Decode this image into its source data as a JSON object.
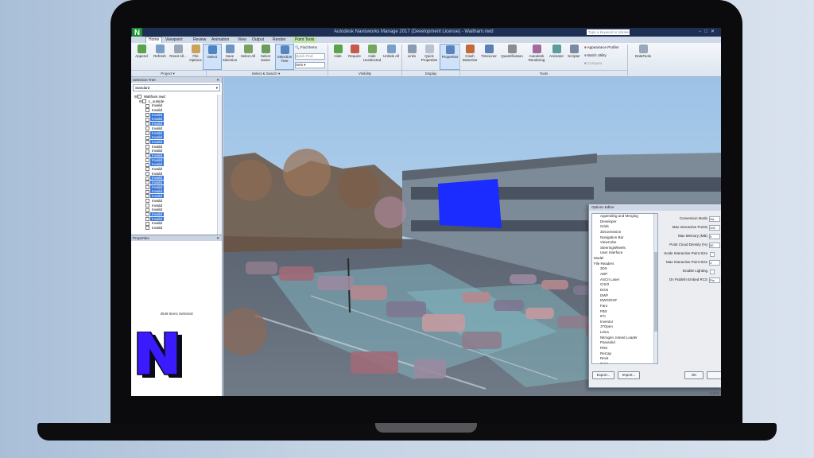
{
  "window": {
    "title": "Autodesk Navisworks Manage 2017 (Development License) - Waltham.nwd",
    "app_icon_letter": "N",
    "search_placeholder": "Type a keyword or phrase",
    "controls": [
      "−",
      "□",
      "✕"
    ]
  },
  "tabs": [
    "Home",
    "Viewpoint",
    "Review",
    "Animation",
    "View",
    "Output",
    "Render",
    "Point Tools"
  ],
  "ribbon": {
    "project_buttons": [
      "Append",
      "Refresh",
      "Reset All...",
      "File Options"
    ],
    "select_buttons": [
      "Select",
      "Save Selection",
      "Select All",
      "Select Same",
      "Selection Tree"
    ],
    "find_items": "Find Items",
    "quick_find_placeholder": "Quick Find",
    "sets_label": "Sets",
    "visibility_buttons": [
      "Hide",
      "Require",
      "Hide Unselected",
      "Unhide All"
    ],
    "display_buttons": [
      "Links",
      "Quick Properties",
      "Properties"
    ],
    "tools_buttons": [
      "Clash Detective",
      "TimeLiner",
      "Quantification",
      "Autodesk Rendering",
      "Animator",
      "Scripter"
    ],
    "tools_small": [
      "Appearance Profiler",
      "Batch Utility",
      "Compare"
    ],
    "datatools": "DataTools",
    "groups": [
      "Project ▾",
      "Select & Search ▾",
      "Visibility",
      "Display",
      "Tools"
    ]
  },
  "selection_tree": {
    "header": "Selection Tree",
    "dropdown": "Standard",
    "root": "Waltham.nwd",
    "child": "L_outside",
    "item_label": "Invalid",
    "item_count": 28,
    "selected_rows": [
      2,
      3,
      4,
      6,
      7,
      8,
      11,
      12,
      13,
      16,
      17,
      18,
      19,
      20,
      24,
      25
    ]
  },
  "properties": {
    "header": "Properties",
    "message": "3648 Items Selected"
  },
  "options_editor": {
    "title": "Options Editor",
    "tree": [
      "Appending and Merging",
      "Developer",
      "Grids",
      "3Dconnexion",
      "Navigation Bar",
      "ViewCube",
      "SteeringWheels",
      "User Interface",
      "Model",
      "File Readers",
      "3DS",
      "ADP",
      "ASCII Laser",
      "CIS/2",
      "DGN",
      "DWF",
      "DWG/DXF",
      "Faro",
      "FBX",
      "IFC",
      "Inventor",
      "JTOpen",
      "Leica",
      "Nitrogen Joined Loader",
      "Parasolid",
      "PDS",
      "ReCap",
      "Revit",
      "RVM"
    ],
    "settings": [
      {
        "label": "Conversion Mode",
        "value": "Siz"
      },
      {
        "label": "Max Interactive Points",
        "value": "100"
      },
      {
        "label": "Max Memory (MB)",
        "value": "9"
      },
      {
        "label": "Point Cloud Density (%)",
        "value": "50"
      },
      {
        "label": "Scale Interactive Point Size",
        "value": ""
      },
      {
        "label": "Max Interactive Point Size",
        "value": "4"
      },
      {
        "label": "Enable Lighting",
        "value": ""
      },
      {
        "label": "On Publish Embed RCS",
        "value": "Fla"
      }
    ],
    "buttons": [
      "Export...",
      "Import...",
      "OK"
    ],
    "status": "1 of 1"
  },
  "colors": {
    "titlebar": "#1d2f52",
    "app_icon": "#1a8f2e",
    "selection": "#3a78d8",
    "logo_fill": "#3a1aff",
    "logo_shadow": "#0a0a1a"
  }
}
